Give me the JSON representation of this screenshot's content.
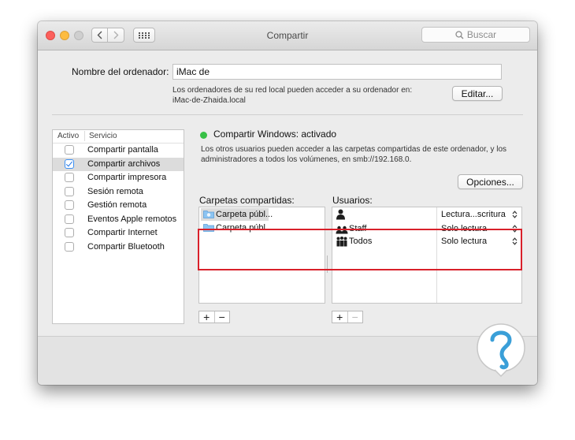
{
  "window": {
    "title": "Compartir"
  },
  "toolbar": {
    "search_placeholder": "Buscar"
  },
  "computer": {
    "label": "Nombre del ordenador:",
    "value": "iMac de",
    "description_line1": "Los ordenadores de su red local pueden acceder a su ordenador en:",
    "description_line2": "iMac-de-Zhaida.local",
    "edit_label": "Editar..."
  },
  "services": {
    "header_active": "Activo",
    "header_service": "Servicio",
    "items": [
      {
        "label": "Compartir pantalla",
        "checked": false
      },
      {
        "label": "Compartir archivos",
        "checked": true
      },
      {
        "label": "Compartir impresora",
        "checked": false
      },
      {
        "label": "Sesión remota",
        "checked": false
      },
      {
        "label": "Gestión remota",
        "checked": false
      },
      {
        "label": "Eventos Apple remotos",
        "checked": false
      },
      {
        "label": "Compartir Internet",
        "checked": false
      },
      {
        "label": "Compartir Bluetooth",
        "checked": false
      }
    ]
  },
  "status": {
    "title": "Compartir Windows: activado",
    "desc_line1": "Los otros usuarios pueden acceder a las carpetas compartidas de este ordenador, y los",
    "desc_line2": "administradores a todos los volúmenes, en smb://192.168.0.",
    "color": "#37c046"
  },
  "options_label": "Opciones...",
  "folders": {
    "label": "Carpetas compartidas:",
    "items": [
      {
        "name": "Carpeta públ..."
      },
      {
        "name": "Carpeta públ..."
      }
    ]
  },
  "users": {
    "label": "Usuarios:",
    "items": [
      {
        "name": "",
        "icon": "person-icon",
        "permission": "Lectura...scritura"
      },
      {
        "name": "Staff",
        "icon": "group-icon",
        "permission": "Solo lectura"
      },
      {
        "name": "Todos",
        "icon": "everyone-icon",
        "permission": "Solo lectura"
      }
    ]
  },
  "buttons": {
    "add": "+",
    "remove": "−"
  },
  "accent": {
    "highlight": "#d9202a",
    "folder": "#7ab8ee"
  }
}
